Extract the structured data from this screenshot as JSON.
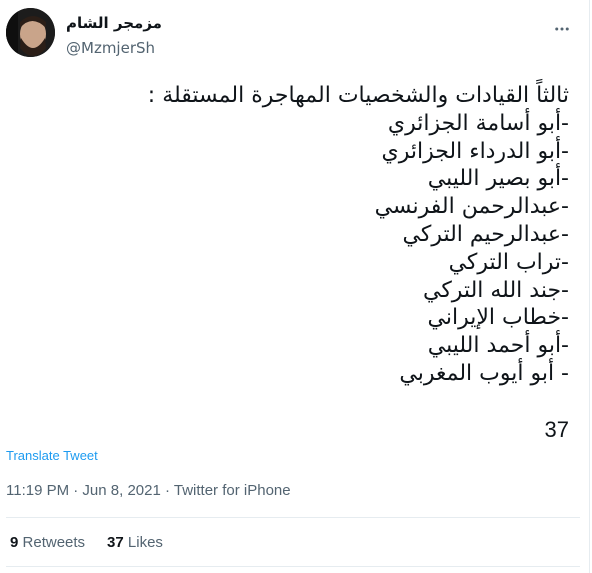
{
  "author": {
    "name": "مزمجر الشام",
    "handle": "@MzmjerSh"
  },
  "tweet": {
    "lines": [
      "ثالثاً القيادات والشخصيات المهاجرة المستقلة :",
      "-أبو أسامة الجزائري",
      "-أبو الدرداء الجزائري",
      "-أبو بصير الليبي",
      "-عبدالرحمن الفرنسي",
      "-عبدالرحيم التركي",
      "-تراب التركي",
      "-جند الله التركي",
      "-خطاب الإيراني",
      "-أبو أحمد الليبي",
      "- أبو أيوب المغربي"
    ],
    "number": "37"
  },
  "translate_label": "Translate Tweet",
  "meta": "11:19 PM · Jun 8, 2021 · Twitter for iPhone",
  "stats": {
    "retweets_count": "9",
    "retweets_label": "Retweets",
    "likes_count": "37",
    "likes_label": "Likes"
  }
}
